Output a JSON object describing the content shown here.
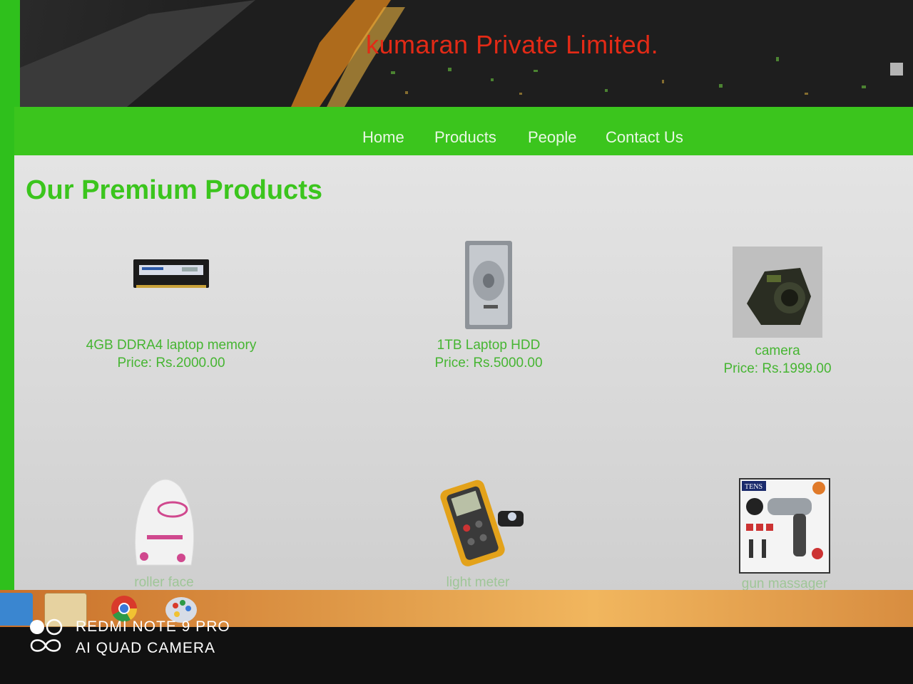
{
  "header": {
    "company_name": "kumaran Private Limited."
  },
  "nav": {
    "items": [
      "Home",
      "Products",
      "People",
      "Contact Us"
    ]
  },
  "main": {
    "title": "Our Premium Products",
    "products": [
      {
        "name": "4GB DDRA4 laptop memory",
        "price": "Price: Rs.2000.00",
        "icon": "ram-module-image"
      },
      {
        "name": "1TB Laptop HDD",
        "price": "Price: Rs.5000.00",
        "icon": "hard-drive-image"
      },
      {
        "name": "camera",
        "price": "Price: Rs.1999.00",
        "icon": "camera-image"
      },
      {
        "name": "roller face",
        "icon": "face-roller-image"
      },
      {
        "name": "light meter",
        "icon": "light-meter-image"
      },
      {
        "name": "gun massager",
        "icon": "gun-massager-image",
        "badge": "TENS"
      }
    ]
  },
  "taskbar": {
    "icons": [
      "edge-icon",
      "folder-icon",
      "chrome-icon",
      "paint-icon"
    ]
  },
  "watermark": {
    "line1": "REDMI NOTE 9 PRO",
    "line2": "AI QUAD CAMERA"
  },
  "colors": {
    "accent_green": "#3bc51d",
    "company_red": "#e32a16",
    "product_text": "#46b532"
  }
}
